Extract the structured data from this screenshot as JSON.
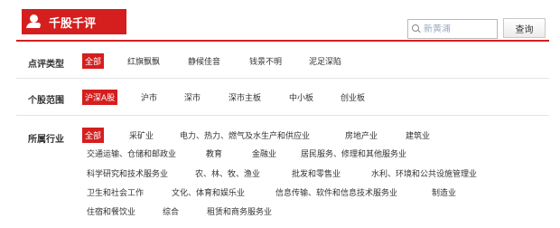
{
  "logo": {
    "text": "千股千评"
  },
  "search": {
    "placeholder": "新黄浦",
    "button": "查询"
  },
  "review_type": {
    "label": "点评类型",
    "options": [
      "全部",
      "红旗飘飘",
      "静候佳音",
      "钱景不明",
      "泥足深陷"
    ],
    "selected": "全部"
  },
  "stock_range": {
    "label": "个股范围",
    "options": [
      "沪深A股",
      "沪市",
      "深市",
      "深市主板",
      "中小板",
      "创业板"
    ],
    "selected": "沪深A股"
  },
  "industry": {
    "label": "所属行业",
    "options": [
      "全部",
      "采矿业",
      "电力、热力、燃气及水生产和供应业",
      "房地产业",
      "建筑业",
      "交通运输、仓储和邮政业",
      "教育",
      "金融业",
      "居民服务、修理和其他服务业",
      "科学研究和技术服务业",
      "农、林、牧、渔业",
      "批发和零售业",
      "水利、环境和公共设施管理业",
      "卫生和社会工作",
      "文化、体育和娱乐业",
      "信息传输、软件和信息技术服务业",
      "制造业",
      "住宿和餐饮业",
      "综合",
      "租赁和商务服务业"
    ],
    "selected": "全部"
  },
  "colors": {
    "accent": "#d51e1e"
  }
}
